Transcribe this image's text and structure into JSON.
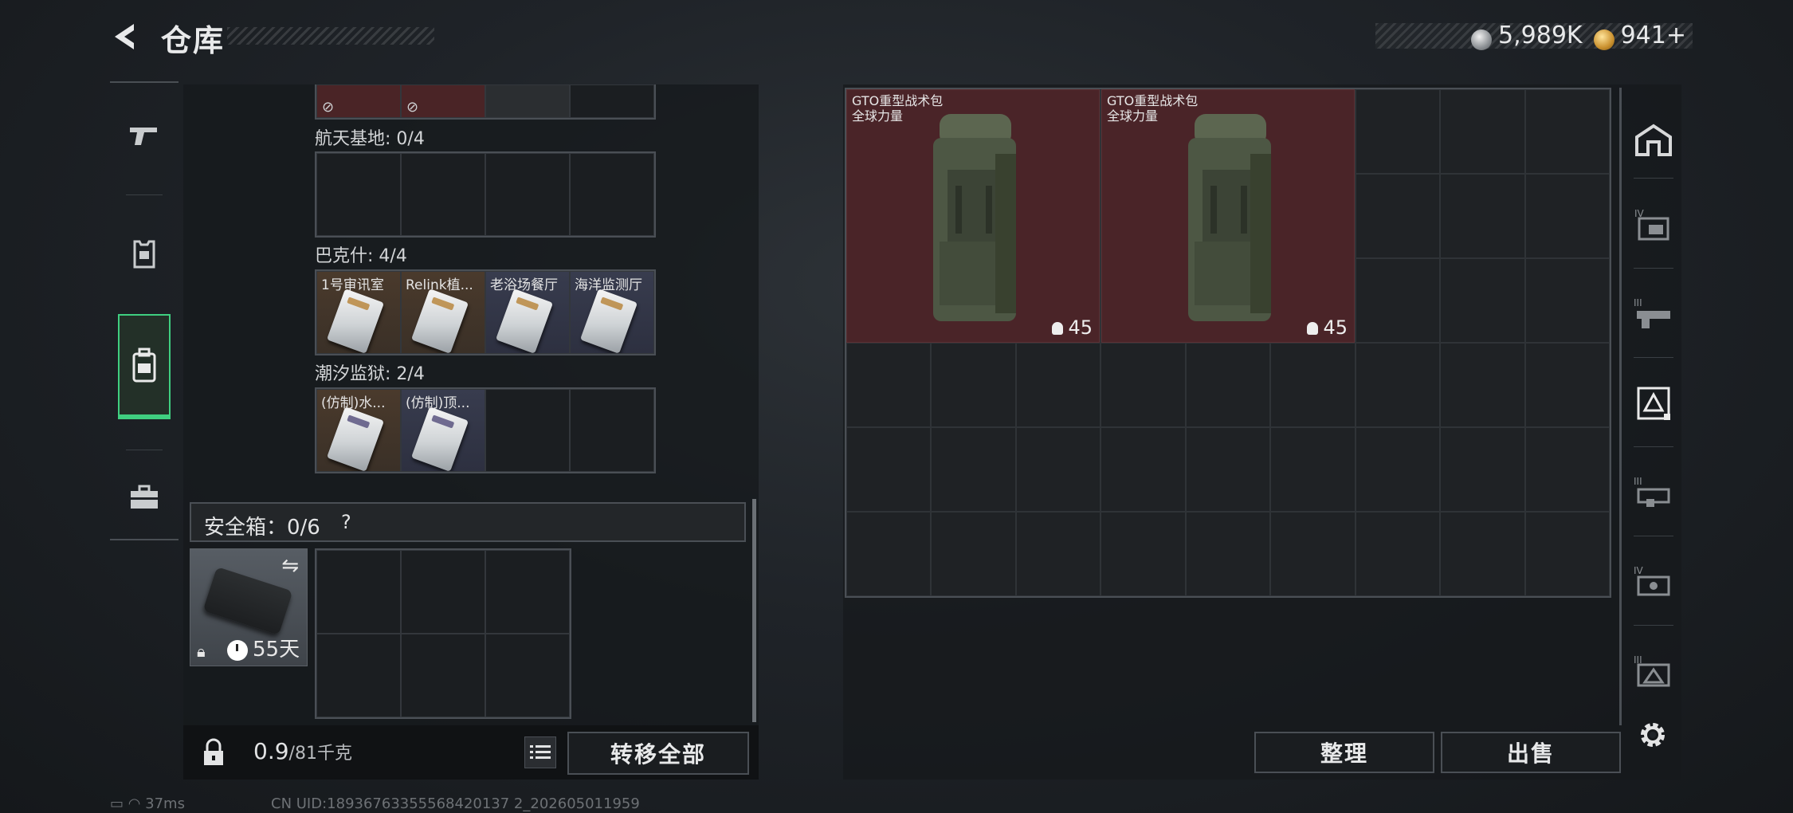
{
  "header": {
    "title": "仓库"
  },
  "currency": {
    "silver": "5,989K",
    "gold": "941",
    "gold_plus": "+"
  },
  "left_sidebar": {
    "icons": [
      "pistol-icon",
      "armor-icon",
      "backpack-icon",
      "toolbox-icon"
    ],
    "active_index": 2
  },
  "keycards": {
    "sections": [
      {
        "label": "航天基地: 0/4",
        "cards": []
      },
      {
        "label": "巴克什: 4/4",
        "cards": [
          "1号审讯室",
          "Relink植...",
          "老浴场餐厅",
          "海洋监测厅"
        ]
      },
      {
        "label": "潮汐监狱: 2/4",
        "cards": [
          "(仿制)水...",
          "(仿制)顶..."
        ]
      }
    ]
  },
  "safe_box": {
    "label": "安全箱：0/6",
    "help": "?",
    "days": "55天"
  },
  "bottom": {
    "weight_value": "0.9",
    "weight_max": "/81千克",
    "transfer_all": "转移全部"
  },
  "stash": {
    "items": [
      {
        "name_line1": "GTO重型战术包",
        "name_line2": "全球力量",
        "count": "45"
      },
      {
        "name_line1": "GTO重型战术包",
        "name_line2": "全球力量",
        "count": "45"
      }
    ],
    "organize": "整理",
    "sell": "出售"
  },
  "right_tabs": {
    "icons": [
      "home-icon",
      "tier4-folder-icon",
      "tier3-weapon-icon",
      "vest-active-icon",
      "tier3-gear-icon",
      "tier4-gear-icon",
      "tier3-case-icon",
      "settings-icon"
    ]
  },
  "status": {
    "ping": "37ms",
    "uid": "CN UID:18936763355568420137 2_202605011959"
  },
  "colors": {
    "accent": "#3fcf80",
    "item_bg": "#4a2428"
  }
}
